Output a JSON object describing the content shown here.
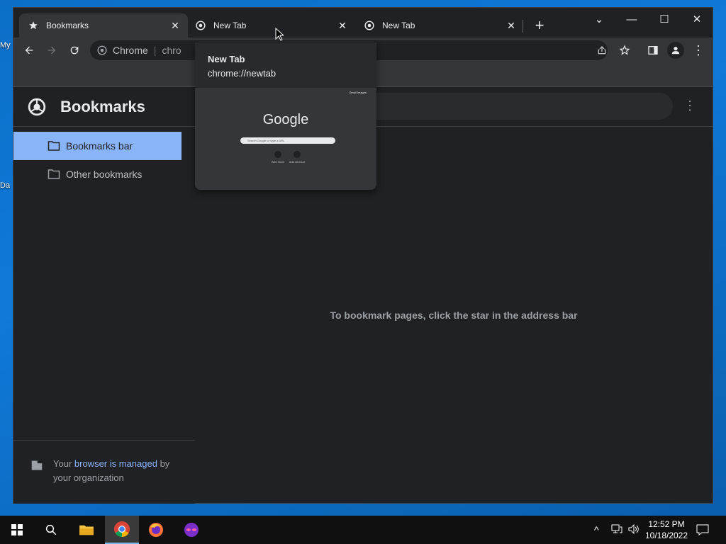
{
  "desktop": {
    "icons": [
      {
        "label": "My",
        "icon": "computer-icon"
      },
      {
        "label": "Da",
        "icon": "file-icon"
      }
    ]
  },
  "browser": {
    "tabs": [
      {
        "label": "Bookmarks",
        "icon": "star-icon",
        "active": true
      },
      {
        "label": "New Tab",
        "icon": "chrome-icon",
        "active": false
      },
      {
        "label": "New Tab",
        "icon": "chrome-icon",
        "active": false
      }
    ],
    "new_tab_label": "+",
    "omnibox": {
      "site_label": "Chrome",
      "url": "chro"
    },
    "window_controls": {
      "tab_search": "⌄",
      "minimize": "—",
      "maximize": "☐",
      "close": "✕"
    }
  },
  "tab_hover_card": {
    "title": "New Tab",
    "url": "chrome://newtab",
    "preview": {
      "logo": "Google",
      "search_placeholder": "Search Google or type a URL",
      "shortcut_1": "Web Store",
      "shortcut_2": "Add shortcut",
      "top_links": "Gmail  Images"
    }
  },
  "bookmarks_app": {
    "title": "Bookmarks",
    "sidebar": [
      {
        "label": "Bookmarks bar",
        "selected": true
      },
      {
        "label": "Other bookmarks",
        "selected": false
      }
    ],
    "managed_notice": {
      "prefix": "Your ",
      "link": "browser is managed",
      "suffix": " by your organization"
    },
    "empty_message": "To bookmark pages, click the star in the address bar"
  },
  "taskbar": {
    "time": "12:52 PM",
    "date": "10/18/2022"
  },
  "colors": {
    "accent": "#8ab4f8",
    "bg": "#202124",
    "toolbar": "#35363a",
    "taskbar": "#101010"
  }
}
